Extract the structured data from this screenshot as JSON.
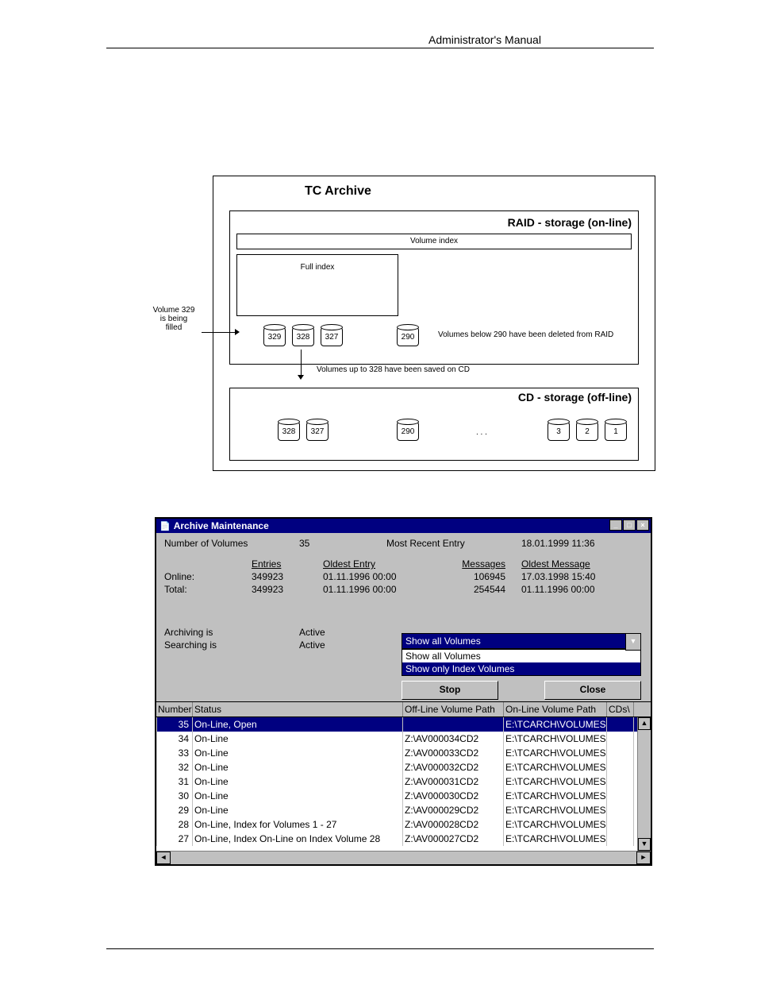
{
  "header": "Administrator's Manual",
  "diagram": {
    "title": "TC Archive",
    "raid_title": "RAID - storage (on-line)",
    "volume_index": "Volume index",
    "full_index": "Full index",
    "annotation_left": "Volume 329\nis being\nfilled",
    "raid_vols": [
      "329",
      "328",
      "327",
      "290"
    ],
    "deleted_note": "Volumes below 290 have been deleted from RAID",
    "saved_note": "Volumes up to 328 have been saved on CD",
    "cd_title": "CD - storage (off-line)",
    "cd_vols_left": [
      "328",
      "327"
    ],
    "cd_vol_mid": "290",
    "cd_dots": ". . .",
    "cd_vols_right": [
      "3",
      "2",
      "1"
    ]
  },
  "dialog": {
    "title": "Archive Maintenance",
    "num_vol_label": "Number of Volumes",
    "num_vol_value": "35",
    "recent_label": "Most Recent Entry",
    "recent_value": "18.01.1999   11:36",
    "entries_h": "Entries",
    "oldest_entry_h": "Oldest Entry",
    "messages_h": "Messages",
    "oldest_msg_h": "Oldest Message",
    "online_label": "Online:",
    "total_label": "Total:",
    "online_entries": "349923",
    "total_entries": "349923",
    "online_oldest": "01.11.1996   00:00",
    "total_oldest": "01.11.1996   00:00",
    "online_msgs": "106945",
    "total_msgs": "254544",
    "online_oldmsg": "17.03.1998   15:40",
    "total_oldmsg": "01.11.1996   00:00",
    "dropdown_selected": "Show all Volumes",
    "dropdown_opts": [
      "Show all Volumes",
      "Show only Index Volumes"
    ],
    "archiving_label": "Archiving is",
    "archiving_value": "Active",
    "searching_label": "Searching is",
    "searching_value": "Active",
    "btn_stop": "Stop",
    "btn_close": "Close",
    "grid_headers": {
      "number": "Number",
      "status": "Status",
      "off": "Off-Line Volume Path",
      "on": "On-Line Volume Path",
      "cds": "CDs\\"
    },
    "rows": [
      {
        "n": "35",
        "s": "On-Line, Open",
        "off": "",
        "on": "E:\\TCARCH\\VOLUMES",
        "sel": true
      },
      {
        "n": "34",
        "s": "On-Line",
        "off": "Z:\\AV000034CD2",
        "on": "E:\\TCARCH\\VOLUMES"
      },
      {
        "n": "33",
        "s": "On-Line",
        "off": "Z:\\AV000033CD2",
        "on": "E:\\TCARCH\\VOLUMES"
      },
      {
        "n": "32",
        "s": "On-Line",
        "off": "Z:\\AV000032CD2",
        "on": "E:\\TCARCH\\VOLUMES"
      },
      {
        "n": "31",
        "s": "On-Line",
        "off": "Z:\\AV000031CD2",
        "on": "E:\\TCARCH\\VOLUMES"
      },
      {
        "n": "30",
        "s": "On-Line",
        "off": "Z:\\AV000030CD2",
        "on": "E:\\TCARCH\\VOLUMES"
      },
      {
        "n": "29",
        "s": "On-Line",
        "off": "Z:\\AV000029CD2",
        "on": "E:\\TCARCH\\VOLUMES"
      },
      {
        "n": "28",
        "s": "On-Line, Index for Volumes 1 - 27",
        "off": "Z:\\AV000028CD2",
        "on": "E:\\TCARCH\\VOLUMES"
      },
      {
        "n": "27",
        "s": "On-Line, Index On-Line on Index Volume 28",
        "off": "Z:\\AV000027CD2",
        "on": "E:\\TCARCH\\VOLUMES"
      }
    ]
  }
}
